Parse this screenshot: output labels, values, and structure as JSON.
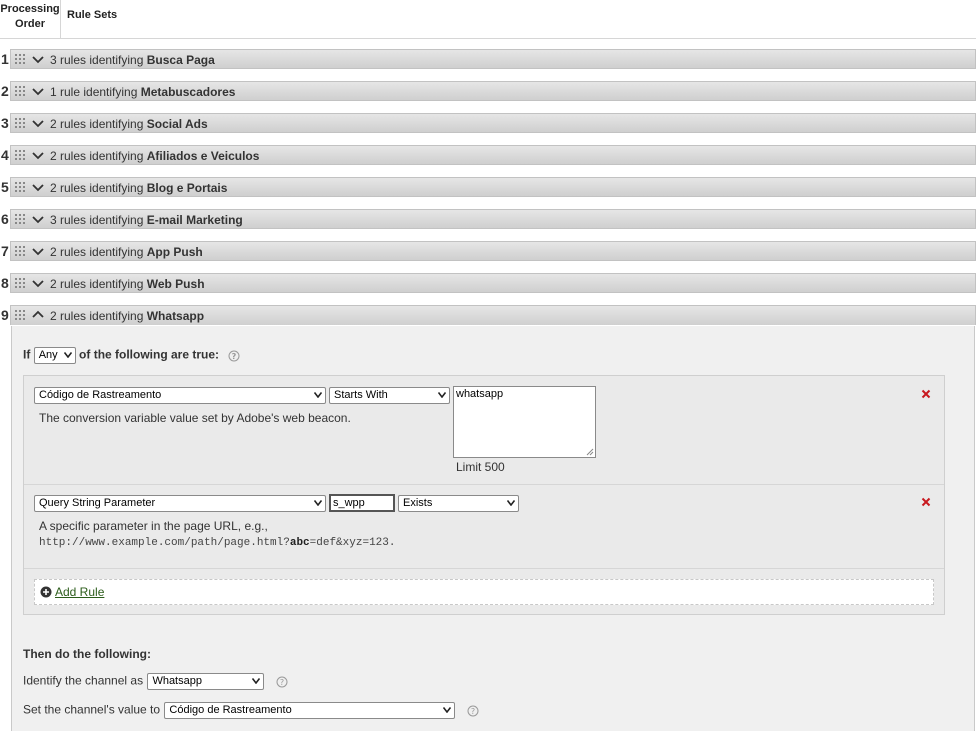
{
  "header": {
    "col_order_line1": "Processing",
    "col_order_line2": "Order",
    "col_rule_sets": "Rule Sets"
  },
  "rows": [
    {
      "num": "1",
      "prefix": "3 rules identifying ",
      "name": "Busca Paga"
    },
    {
      "num": "2",
      "prefix": "1 rule identifying ",
      "name": "Metabuscadores"
    },
    {
      "num": "3",
      "prefix": "2 rules identifying ",
      "name": "Social Ads"
    },
    {
      "num": "4",
      "prefix": "2 rules identifying ",
      "name": "Afiliados e Veiculos"
    },
    {
      "num": "5",
      "prefix": "2 rules identifying ",
      "name": "Blog e Portais"
    },
    {
      "num": "6",
      "prefix": "3 rules identifying ",
      "name": "E-mail Marketing"
    },
    {
      "num": "7",
      "prefix": "2 rules identifying ",
      "name": "App Push"
    },
    {
      "num": "8",
      "prefix": "2 rules identifying ",
      "name": "Web Push"
    },
    {
      "num": "9",
      "prefix": "2 rules identifying ",
      "name": "Whatsapp"
    }
  ],
  "expanded": {
    "if_label": "If",
    "match_value": "Any",
    "following_label": "of the following are true:",
    "rule1": {
      "field": "Código de Rastreamento",
      "operator": "Starts With",
      "value": "whatsapp",
      "description": "The conversion variable value set by Adobe's web beacon.",
      "limit": "Limit 500"
    },
    "rule2": {
      "field": "Query String Parameter",
      "param": "s_wpp",
      "operator": "Exists",
      "description": "A specific parameter in the page URL, e.g.,",
      "example_pre": "http://www.example.com/path/page.html?",
      "example_bold": "abc",
      "example_post": "=def&xyz=123."
    },
    "add_rule": "Add Rule",
    "then_label": "Then do the following:",
    "identify_label": "Identify the channel as",
    "identify_value": "Whatsapp",
    "set_value_label": "Set the channel's value to",
    "set_value_value": "Código de Rastreamento"
  },
  "colors": {
    "delete": "#c8191f",
    "link": "#2b5c1a",
    "bar_top": "#e6e6e6",
    "bar_bottom": "#cfcfcf"
  },
  "icons": [
    "grip-icon",
    "chevron-down-icon",
    "chevron-up-icon",
    "help-icon",
    "delete-icon",
    "plus-circle-icon"
  ]
}
